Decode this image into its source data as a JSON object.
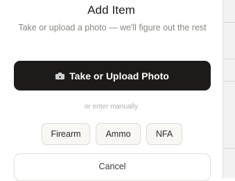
{
  "dialog": {
    "title": "Add Item",
    "subtitle": "Take or upload a photo — we'll figure out the rest",
    "primary_action": {
      "label": "Take or Upload Photo",
      "icon": "camera-icon"
    },
    "divider_text": "or enter manually",
    "categories": [
      {
        "label": "Firearm"
      },
      {
        "label": "Ammo"
      },
      {
        "label": "NFA"
      }
    ],
    "cancel_label": "Cancel"
  },
  "colors": {
    "primary_button_bg": "#1d1b19",
    "primary_button_text": "#ffffff",
    "subtitle_text": "#8a8782",
    "chip_bg": "#f8f7f4",
    "chip_border": "#dddad4"
  }
}
